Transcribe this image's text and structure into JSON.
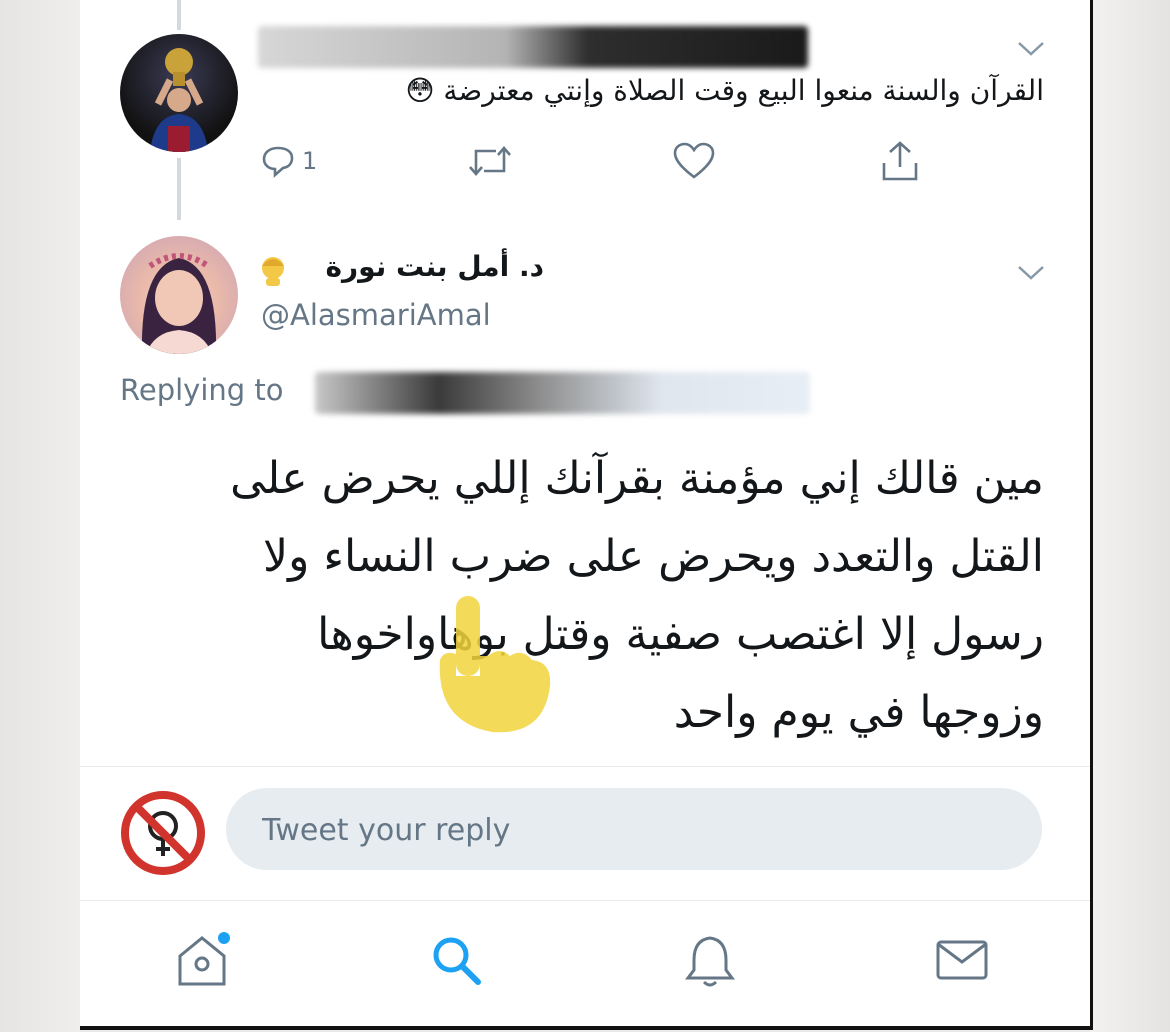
{
  "tweet_parent": {
    "text": "القرآن والسنة منعوا البيع وقت الصلاة وإنتي معترضة 😳",
    "reply_count": "1"
  },
  "tweet_main": {
    "display_name": "د. أمل بنت نورة",
    "handle": "@AlasmariAmal",
    "replying_to_label": "Replying to",
    "body_lines": [
      "مين قالك إني مؤمنة بقرآنك إللي يحرض على",
      "القتل والتعدد ويحرض على ضرب النساء ولا",
      "رسول إلا اغتصب صفية وقتل بوهاواخوها",
      "وزوجها في يوم واحد"
    ]
  },
  "reply_box": {
    "placeholder": "Tweet your reply"
  },
  "icons": {
    "reply": "reply-icon",
    "retweet": "retweet-icon",
    "like": "heart-icon",
    "share": "share-icon",
    "caret": "chevron-down-icon",
    "home": "home-icon",
    "search": "search-icon",
    "notifications": "bell-icon",
    "messages": "mail-icon"
  },
  "colors": {
    "accent": "#1da1f2",
    "muted": "#657786",
    "reply_field_bg": "#e6ecf0",
    "no_symbol_red": "#d0342c",
    "pointer_hand": "#f2d33c"
  }
}
